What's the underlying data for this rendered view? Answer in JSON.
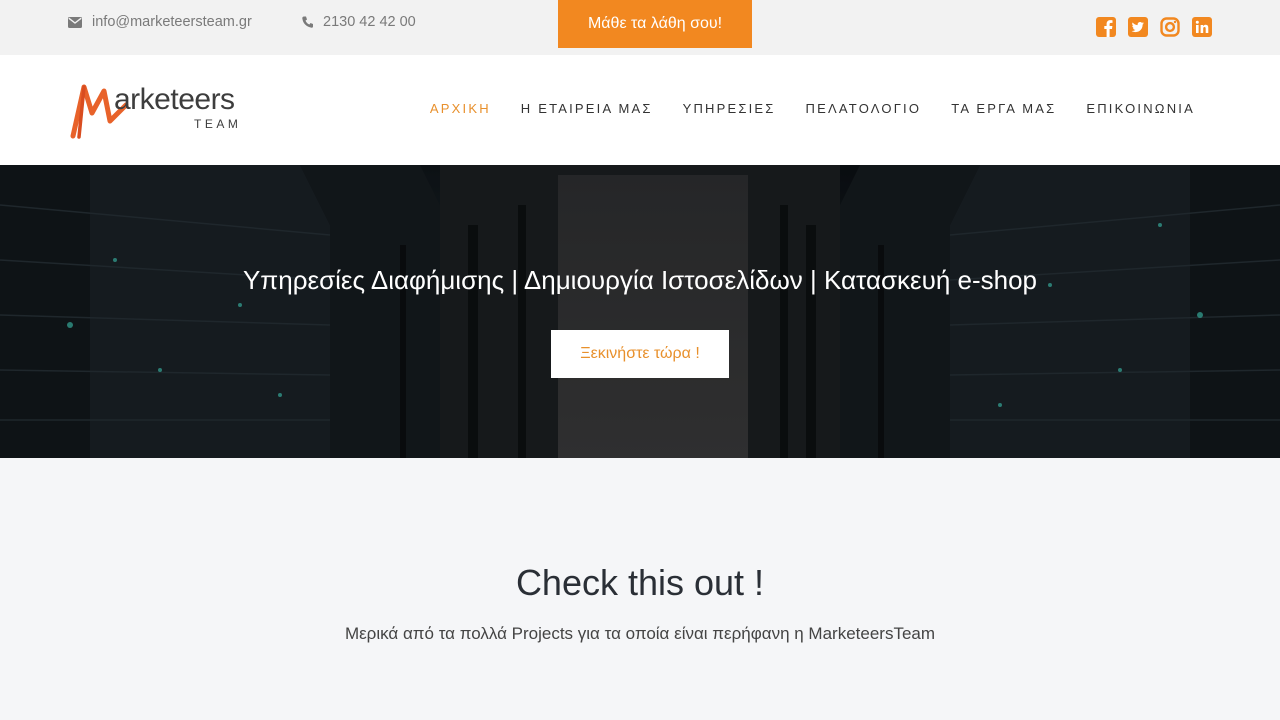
{
  "topbar": {
    "email": "info@marketeersteam.gr",
    "phone": "2130 42 42 00",
    "cta_label": "Μάθε τα λάθη σου!",
    "socials": [
      "facebook-icon",
      "twitter-icon",
      "instagram-icon",
      "linkedin-icon"
    ]
  },
  "logo": {
    "word": "arketeers",
    "team": "TEAM"
  },
  "nav": {
    "items": [
      {
        "label": "ΑΡΧΙΚΗ",
        "active": true
      },
      {
        "label": "Η ΕΤΑΙΡΕΙΑ ΜΑΣ"
      },
      {
        "label": "ΥΠΗΡΕΣΙΕΣ"
      },
      {
        "label": "ΠΕΛΑΤΟΛΟΓΙΟ"
      },
      {
        "label": "ΤΑ ΕΡΓΑ ΜΑΣ"
      },
      {
        "label": "ΕΠΙΚΟΙΝΩΝΙΑ"
      }
    ]
  },
  "hero": {
    "title": "Υπηρεσίες Διαφήμισης | Δημιουργία Ιστοσελίδων | Κατασκευή e-shop",
    "button_label": "Ξεκινήστε τώρα !"
  },
  "section": {
    "title": "Check this out !",
    "subtitle": "Μερικά από τα πολλά Projects για τα οποία είναι περήφανη η MarketeersTeam"
  },
  "colors": {
    "accent": "#f28820",
    "nav_active": "#e8902c",
    "topbar_bg": "#f2f2f2",
    "section_bg": "#f5f6f8"
  }
}
